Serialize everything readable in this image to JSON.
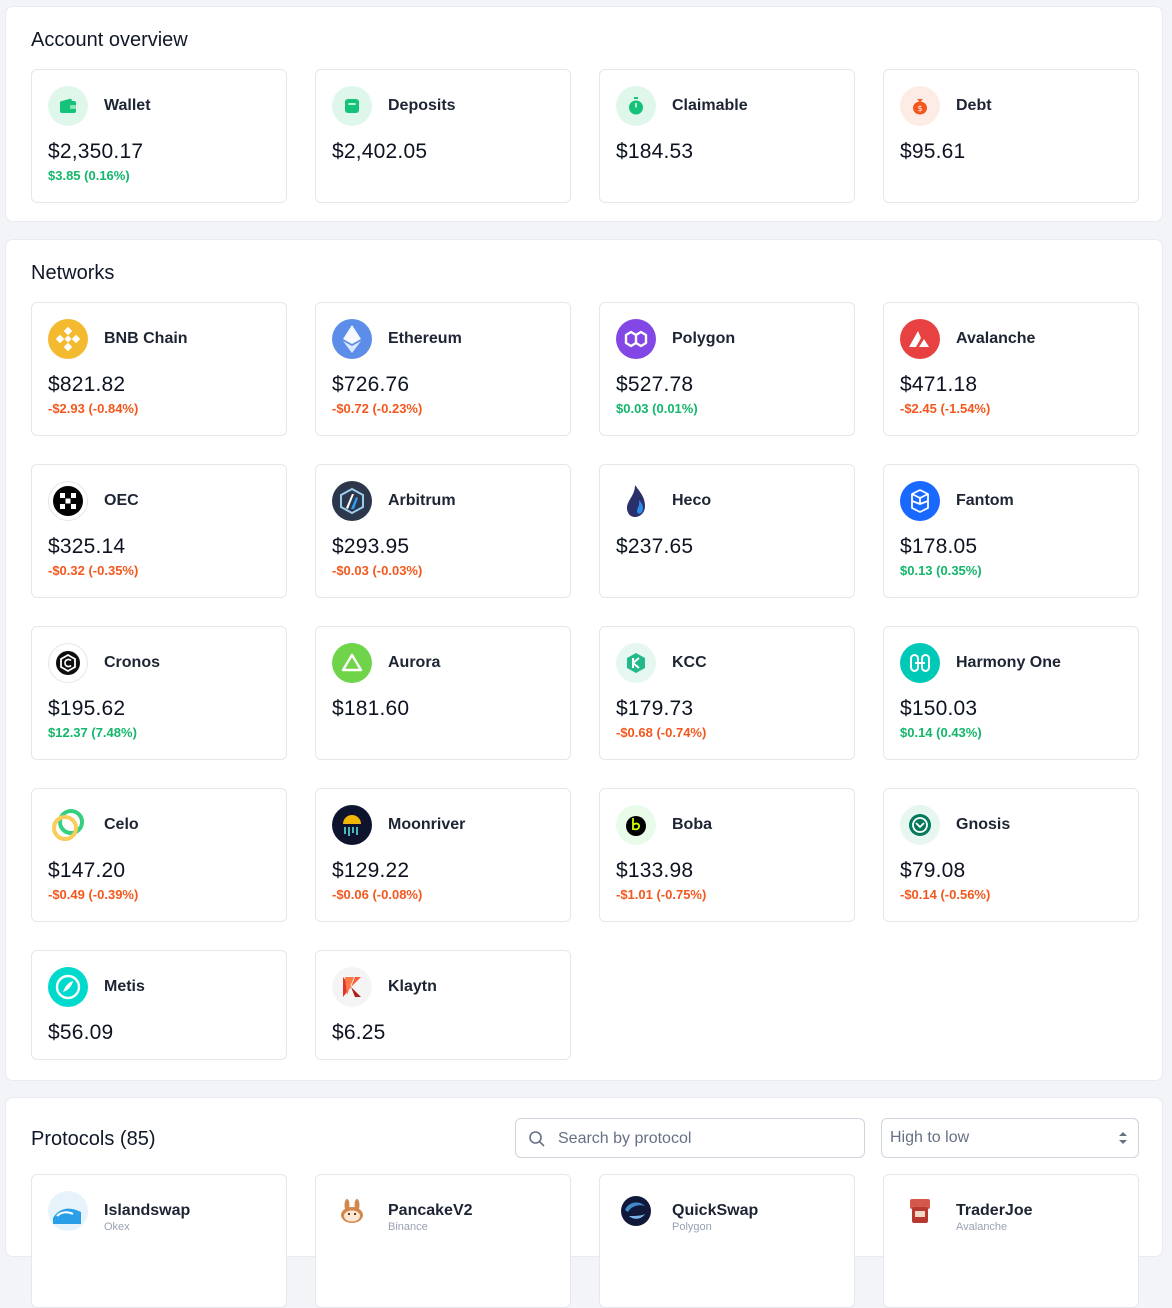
{
  "overview": {
    "title": "Account overview",
    "cards": [
      {
        "name": "Wallet",
        "value": "$2,350.17",
        "change": "$3.85 (0.16%)",
        "trend": "up"
      },
      {
        "name": "Deposits",
        "value": "$2,402.05",
        "change": "",
        "trend": "none"
      },
      {
        "name": "Claimable",
        "value": "$184.53",
        "change": "",
        "trend": "none"
      },
      {
        "name": "Debt",
        "value": "$95.61",
        "change": "",
        "trend": "none"
      }
    ]
  },
  "networks": {
    "title": "Networks",
    "cards": [
      {
        "name": "BNB Chain",
        "value": "$821.82",
        "change": "-$2.93 (-0.84%)",
        "trend": "down",
        "icon": "bnb-chain-icon"
      },
      {
        "name": "Ethereum",
        "value": "$726.76",
        "change": "-$0.72 (-0.23%)",
        "trend": "down",
        "icon": "ethereum-icon"
      },
      {
        "name": "Polygon",
        "value": "$527.78",
        "change": "$0.03 (0.01%)",
        "trend": "up",
        "icon": "polygon-icon"
      },
      {
        "name": "Avalanche",
        "value": "$471.18",
        "change": "-$2.45 (-1.54%)",
        "trend": "down",
        "icon": "avalanche-icon"
      },
      {
        "name": "OEC",
        "value": "$325.14",
        "change": "-$0.32 (-0.35%)",
        "trend": "down",
        "icon": "oec-icon"
      },
      {
        "name": "Arbitrum",
        "value": "$293.95",
        "change": "-$0.03 (-0.03%)",
        "trend": "down",
        "icon": "arbitrum-icon"
      },
      {
        "name": "Heco",
        "value": "$237.65",
        "change": "",
        "trend": "none",
        "icon": "heco-icon"
      },
      {
        "name": "Fantom",
        "value": "$178.05",
        "change": "$0.13 (0.35%)",
        "trend": "up",
        "icon": "fantom-icon"
      },
      {
        "name": "Cronos",
        "value": "$195.62",
        "change": "$12.37 (7.48%)",
        "trend": "up",
        "icon": "cronos-icon"
      },
      {
        "name": "Aurora",
        "value": "$181.60",
        "change": "",
        "trend": "none",
        "icon": "aurora-icon"
      },
      {
        "name": "KCC",
        "value": "$179.73",
        "change": "-$0.68 (-0.74%)",
        "trend": "down",
        "icon": "kcc-icon"
      },
      {
        "name": "Harmony One",
        "value": "$150.03",
        "change": "$0.14 (0.43%)",
        "trend": "up",
        "icon": "harmony-one-icon"
      },
      {
        "name": "Celo",
        "value": "$147.20",
        "change": "-$0.49 (-0.39%)",
        "trend": "down",
        "icon": "celo-icon"
      },
      {
        "name": "Moonriver",
        "value": "$129.22",
        "change": "-$0.06 (-0.08%)",
        "trend": "down",
        "icon": "moonriver-icon"
      },
      {
        "name": "Boba",
        "value": "$133.98",
        "change": "-$1.01 (-0.75%)",
        "trend": "down",
        "icon": "boba-icon"
      },
      {
        "name": "Gnosis",
        "value": "$79.08",
        "change": "-$0.14 (-0.56%)",
        "trend": "down",
        "icon": "gnosis-icon"
      },
      {
        "name": "Metis",
        "value": "$56.09",
        "change": "",
        "trend": "none",
        "icon": "metis-icon"
      },
      {
        "name": "Klaytn",
        "value": "$6.25",
        "change": "",
        "trend": "none",
        "icon": "klaytn-icon"
      }
    ]
  },
  "protocols": {
    "title": "Protocols (85)",
    "search_placeholder": "Search by protocol",
    "sort_label": "High to low",
    "cards": [
      {
        "name": "Islandswap",
        "network": "Okex",
        "icon": "islandswap-icon"
      },
      {
        "name": "PancakeV2",
        "network": "Binance",
        "icon": "pancakeswap-icon"
      },
      {
        "name": "QuickSwap",
        "network": "Polygon",
        "icon": "quickswap-icon"
      },
      {
        "name": "TraderJoe",
        "network": "Avalanche",
        "icon": "traderjoe-icon"
      }
    ]
  },
  "colors": {
    "positive": "#12b76a",
    "negative": "#f2581e",
    "accent": "#12c07a"
  }
}
